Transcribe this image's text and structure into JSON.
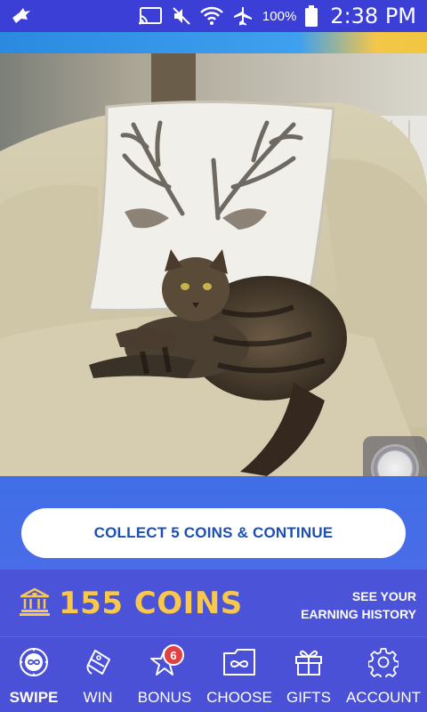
{
  "status_bar": {
    "battery": "100%",
    "time": "2:38 PM",
    "icons": [
      "bird-icon",
      "cast-icon",
      "mute-icon",
      "wifi-icon",
      "airplane-icon",
      "battery-icon"
    ]
  },
  "content": {
    "image_description": "Tabby cat sitting on a cream armchair in front of a pillow with deer antlers print"
  },
  "cta": {
    "label": "COLLECT 5 COINS & CONTINUE"
  },
  "coins": {
    "value": "155 COINS",
    "history_line1": "SEE YOUR",
    "history_line2": "EARNING HISTORY",
    "accent_color": "#f9c74a"
  },
  "tabs": [
    {
      "label": "SWIPE",
      "icon": "swipe-icon",
      "active": true
    },
    {
      "label": "WIN",
      "icon": "win-icon",
      "active": false
    },
    {
      "label": "BONUS",
      "icon": "bonus-icon",
      "active": false,
      "badge": "6"
    },
    {
      "label": "CHOOSE",
      "icon": "choose-icon",
      "active": false
    },
    {
      "label": "GIFTS",
      "icon": "gift-icon",
      "active": false
    },
    {
      "label": "ACCOUNT",
      "icon": "gear-icon",
      "active": false
    }
  ]
}
